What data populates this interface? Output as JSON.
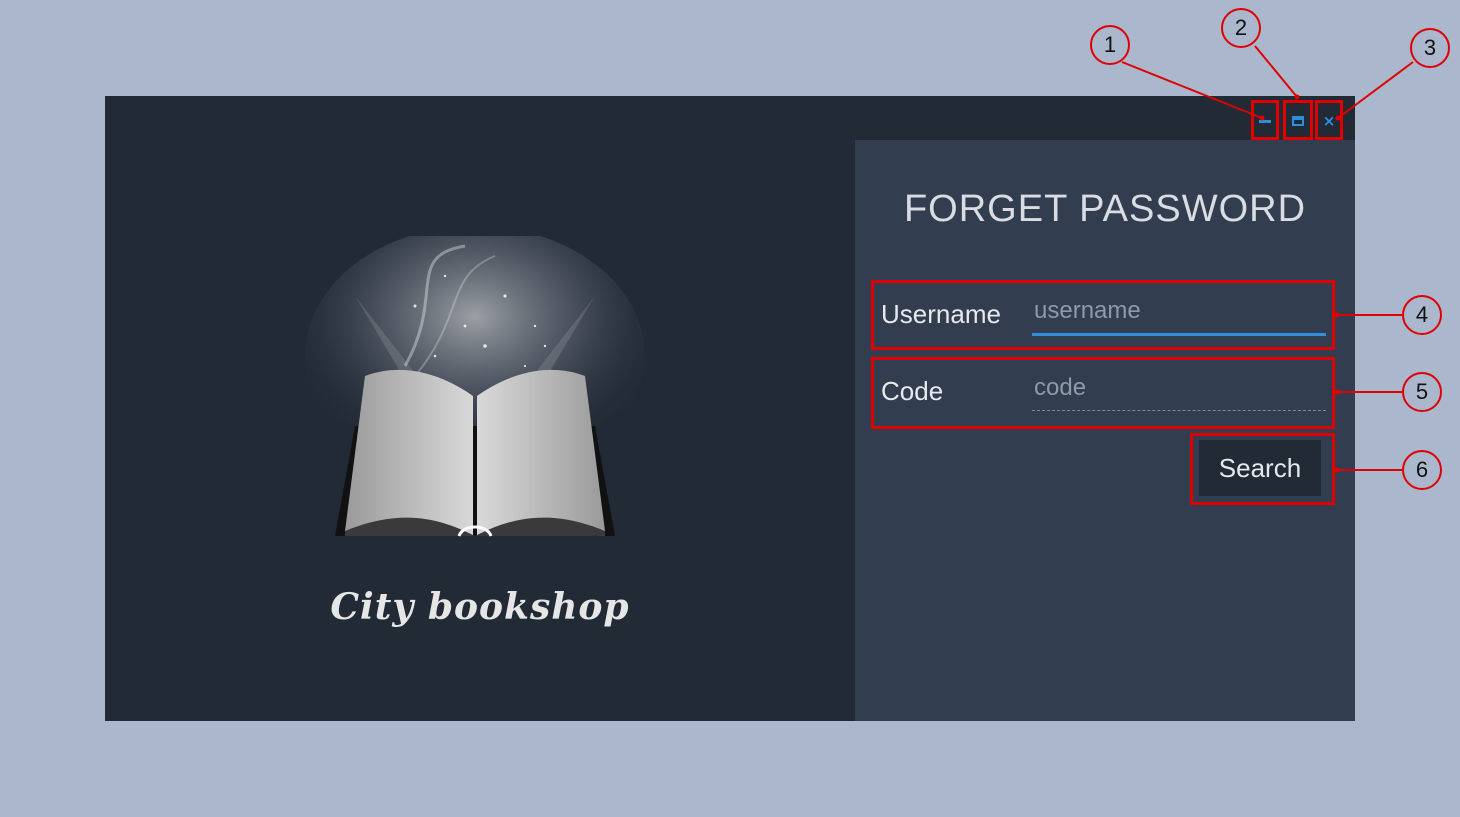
{
  "window": {
    "controls": {
      "minimize_icon": "minimize-icon",
      "maximize_icon": "maximize-icon",
      "close_glyph": "×"
    }
  },
  "branding": {
    "app_name": "City bookshop"
  },
  "form": {
    "title": "FORGET PASSWORD",
    "username": {
      "label": "Username",
      "placeholder": "username",
      "value": ""
    },
    "code": {
      "label": "Code",
      "placeholder": "code",
      "value": ""
    },
    "search_label": "Search"
  },
  "annotations": {
    "callouts": [
      "1",
      "2",
      "3",
      "4",
      "5",
      "6"
    ]
  },
  "colors": {
    "background": "#aab7cc",
    "window": "#222a36",
    "panel": "#323d4f",
    "accent": "#2f8fdc",
    "annotation": "#e00000"
  }
}
